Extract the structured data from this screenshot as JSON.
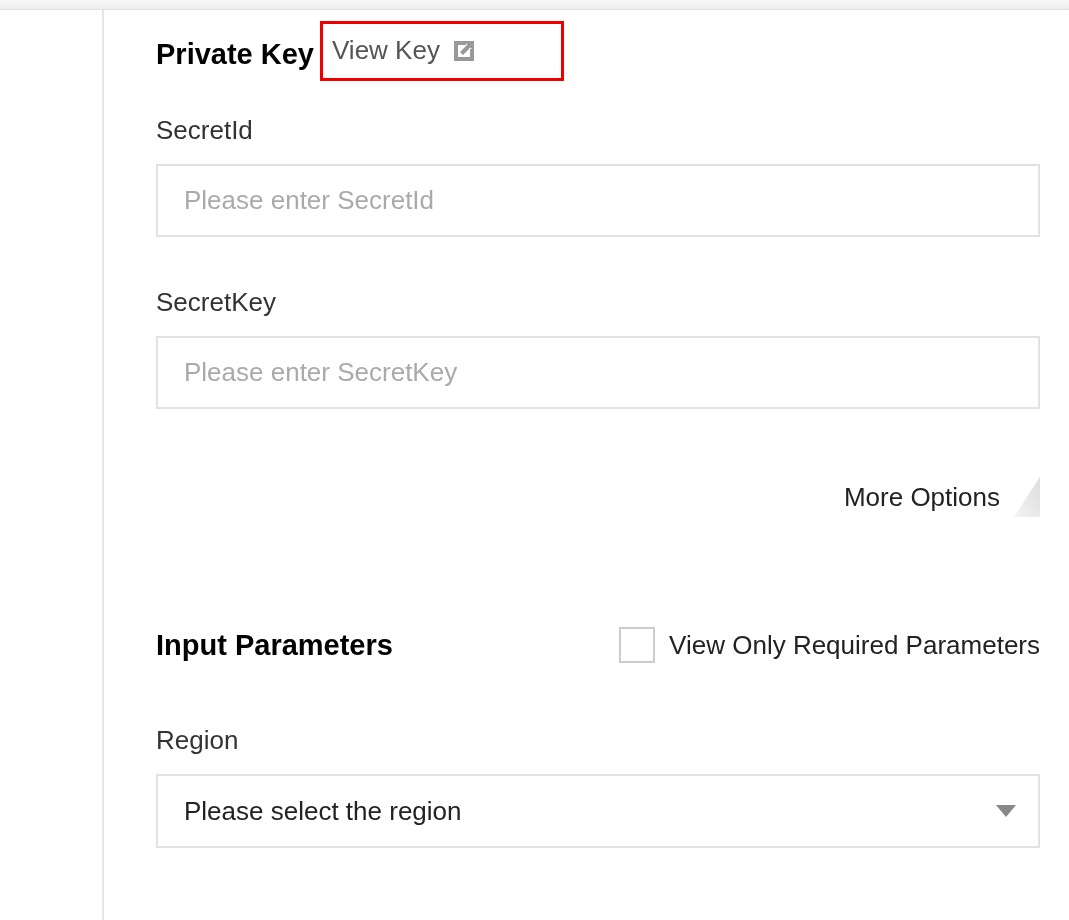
{
  "private_key": {
    "title": "Private Key",
    "link": "View Key"
  },
  "fields": [
    {
      "label": "SecretId",
      "placeholder": "Please enter SecretId"
    },
    {
      "label": "SecretKey",
      "placeholder": "Please enter SecretKey"
    }
  ],
  "more_options": "More Options",
  "input_parameters": {
    "title": "Input Parameters",
    "filter": {
      "label": "View Only Required Parameters",
      "checked": false
    }
  },
  "region": {
    "label": "Region",
    "value": "Please select the region"
  }
}
